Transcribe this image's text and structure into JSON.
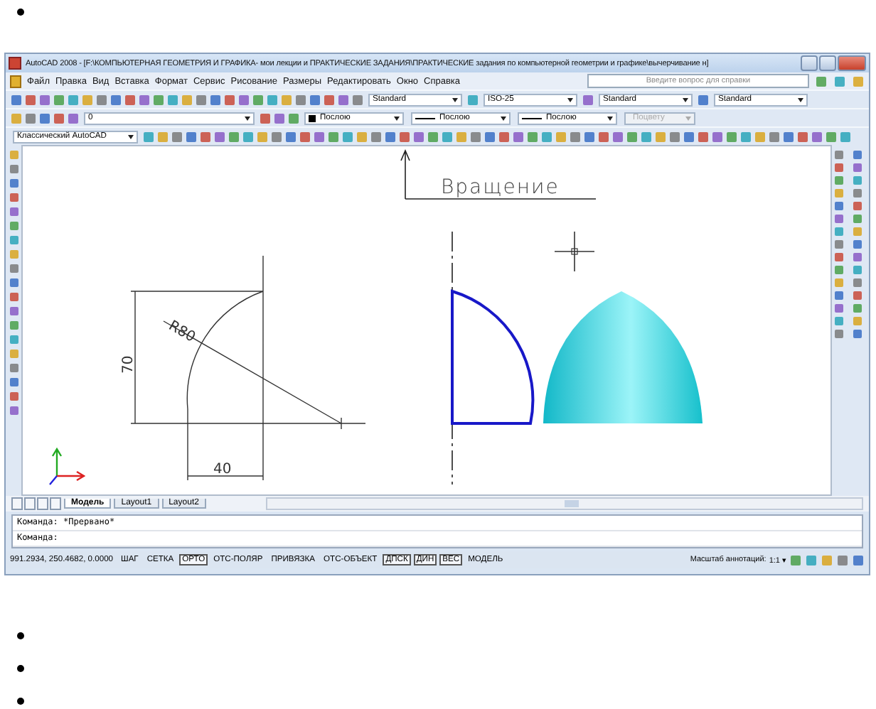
{
  "window": {
    "title": "AutoCAD 2008 - [F:\\КОМПЬЮТЕРНАЯ ГЕОМЕТРИЯ И ГРАФИКА- мои лекции и ПРАКТИЧЕСКИЕ ЗАДАНИЯ\\ПРАКТИЧЕСКИЕ задания по компьютерной геометрии и графике\\вычерчивание н]"
  },
  "menu": [
    "Файл",
    "Правка",
    "Вид",
    "Вставка",
    "Формат",
    "Сервис",
    "Рисование",
    "Размеры",
    "Редактировать",
    "Окно",
    "Справка"
  ],
  "help_search": {
    "placeholder": "Введите вопрос для справки"
  },
  "style_dropdowns": [
    {
      "value": "Standard"
    },
    {
      "value": "ISO-25"
    },
    {
      "value": "Standard"
    },
    {
      "value": "Standard"
    }
  ],
  "layer_dropdown": {
    "value": "0"
  },
  "property_dropdowns": [
    {
      "value": "Послою",
      "kind": "color",
      "disabled": false
    },
    {
      "value": "Послою",
      "kind": "linetype",
      "disabled": false
    },
    {
      "value": "Послою",
      "kind": "lineweight",
      "disabled": false
    },
    {
      "value": "Поцвету",
      "kind": "plot",
      "disabled": true
    }
  ],
  "workspace_dropdown": {
    "value": "Классический AutoCAD"
  },
  "drawing": {
    "callout": "Вращение",
    "radius_label": "R80",
    "height_label": "70",
    "width_label": "40"
  },
  "layout_tabs": [
    {
      "label": "Модель",
      "selected": true
    },
    {
      "label": "Layout1",
      "selected": false
    },
    {
      "label": "Layout2",
      "selected": false
    }
  ],
  "command_lines": [
    "Команда: *Прервано*",
    "Команда:"
  ],
  "status_bar": {
    "coordinates": "991.2934, 250.4682, 0.0000",
    "toggles": [
      {
        "label": "ШАГ",
        "on": false
      },
      {
        "label": "СЕТКА",
        "on": false
      },
      {
        "label": "ОРТО",
        "on": true
      },
      {
        "label": "ОТС-ПОЛЯР",
        "on": false
      },
      {
        "label": "ПРИВЯЗКА",
        "on": false
      },
      {
        "label": "ОТС-ОБЪЕКТ",
        "on": false
      },
      {
        "label": "ДПСК",
        "on": true
      },
      {
        "label": "ДИН",
        "on": true
      },
      {
        "label": "ВЕС",
        "on": true
      },
      {
        "label": "МОДЕЛЬ",
        "on": false
      }
    ],
    "annotation_label": "Масштаб аннотаций:",
    "annotation_scale": "1:1 ▾"
  }
}
